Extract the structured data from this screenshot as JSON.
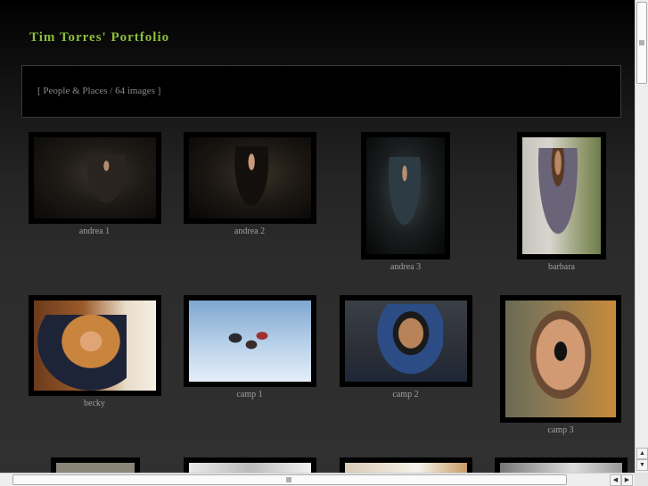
{
  "site": {
    "title": "Tim Torres' Portfolio"
  },
  "breadcrumb": {
    "text": "[ People & Places / 64 images ]"
  },
  "gallery": {
    "items": [
      {
        "caption": "andrea 1"
      },
      {
        "caption": "andrea 2"
      },
      {
        "caption": "andrea 3"
      },
      {
        "caption": "barbara"
      },
      {
        "caption": "becky"
      },
      {
        "caption": "camp 1"
      },
      {
        "caption": "camp 2"
      },
      {
        "caption": "camp 3"
      }
    ]
  },
  "scrollbars": {
    "up_arrow": "▲",
    "down_arrow": "▼",
    "left_arrow": "◀",
    "right_arrow": "▶"
  }
}
